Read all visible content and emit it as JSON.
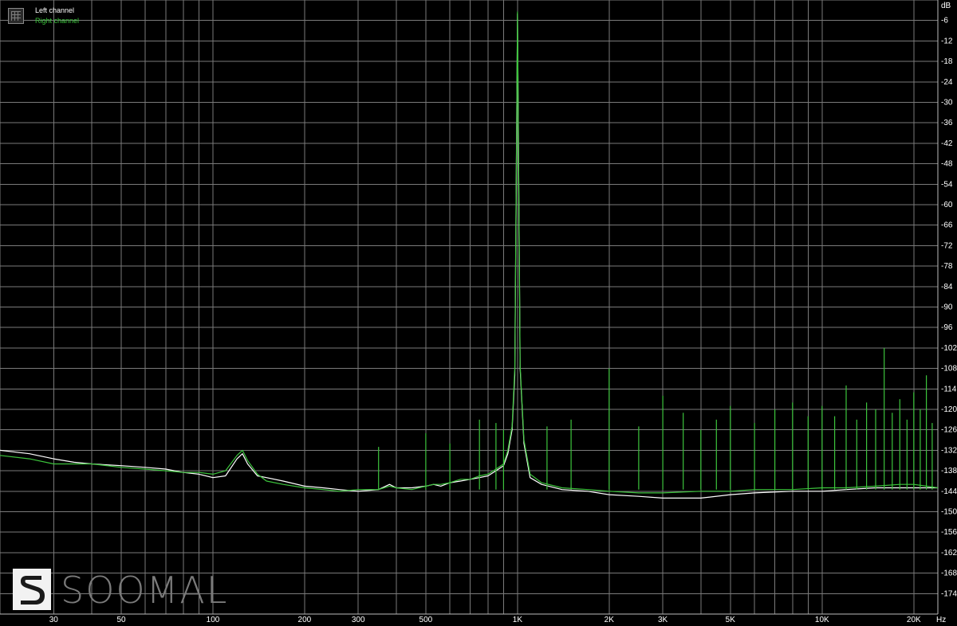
{
  "legend": {
    "left": "Left channel",
    "right": "Right channel"
  },
  "logo": {
    "text": "SOOMAL"
  },
  "colors": {
    "background": "#000000",
    "grid": "#7a7a7a",
    "left_channel": "#ffffff",
    "right_channel": "#3cc43c"
  },
  "chart_data": {
    "type": "line",
    "title": "",
    "xlabel": "Hz",
    "ylabel": "dB",
    "x_scale": "log",
    "xlim": [
      20,
      24000
    ],
    "ylim": [
      -180,
      0
    ],
    "grid": true,
    "legend_position": "top-left",
    "x_ticks": [
      {
        "value": 30,
        "label": "30"
      },
      {
        "value": 50,
        "label": "50"
      },
      {
        "value": 100,
        "label": "100"
      },
      {
        "value": 200,
        "label": "200"
      },
      {
        "value": 300,
        "label": "300"
      },
      {
        "value": 500,
        "label": "500"
      },
      {
        "value": 1000,
        "label": "1K"
      },
      {
        "value": 2000,
        "label": "2K"
      },
      {
        "value": 3000,
        "label": "3K"
      },
      {
        "value": 5000,
        "label": "5K"
      },
      {
        "value": 10000,
        "label": "10K"
      },
      {
        "value": 20000,
        "label": "20K"
      }
    ],
    "y_ticks": [
      -6,
      -12,
      -18,
      -24,
      -30,
      -36,
      -42,
      -48,
      -54,
      -60,
      -66,
      -72,
      -78,
      -84,
      -90,
      -96,
      -102,
      -108,
      -114,
      -120,
      -126,
      -132,
      -138,
      -144,
      -150,
      -156,
      -162,
      -168,
      -174
    ],
    "series": [
      {
        "name": "Left channel",
        "color": "#ffffff",
        "x": [
          20,
          25,
          30,
          35,
          40,
          50,
          60,
          70,
          80,
          90,
          100,
          110,
          120,
          125,
          130,
          140,
          150,
          170,
          200,
          230,
          260,
          300,
          350,
          380,
          400,
          450,
          500,
          530,
          560,
          600,
          650,
          700,
          750,
          800,
          850,
          900,
          930,
          960,
          980,
          1000,
          1020,
          1050,
          1100,
          1200,
          1400,
          1700,
          2000,
          2500,
          3000,
          4000,
          5000,
          6000,
          8000,
          10000,
          12000,
          15000,
          18000,
          20000,
          22000,
          24000
        ],
        "y": [
          -132,
          -133,
          -134.5,
          -135.5,
          -136,
          -136.5,
          -137,
          -137.5,
          -138.5,
          -139,
          -140,
          -139.5,
          -134.5,
          -133,
          -136,
          -139.5,
          -140,
          -141,
          -142.5,
          -143,
          -143.5,
          -144,
          -143.5,
          -142,
          -143,
          -143,
          -142.5,
          -142,
          -142.5,
          -141.5,
          -141,
          -140.5,
          -140,
          -139.5,
          -138,
          -136.5,
          -133,
          -126,
          -110,
          -4,
          -108,
          -130,
          -140,
          -142,
          -143.5,
          -144,
          -145,
          -145.5,
          -146,
          -146,
          -145,
          -144.5,
          -144,
          -144,
          -143.5,
          -143,
          -143,
          -143,
          -143,
          -143
        ]
      },
      {
        "name": "Right channel",
        "color": "#3cc43c",
        "x": [
          20,
          25,
          30,
          35,
          40,
          50,
          60,
          70,
          80,
          90,
          100,
          110,
          120,
          125,
          130,
          140,
          150,
          170,
          200,
          230,
          260,
          300,
          350,
          380,
          400,
          450,
          500,
          530,
          560,
          600,
          650,
          700,
          750,
          800,
          850,
          900,
          930,
          960,
          980,
          1000,
          1020,
          1050,
          1100,
          1200,
          1400,
          1700,
          2000,
          2500,
          3000,
          4000,
          5000,
          6000,
          8000,
          10000,
          12000,
          15000,
          18000,
          20000,
          22000,
          24000
        ],
        "y": [
          -133.5,
          -134.5,
          -136,
          -136,
          -136,
          -137,
          -137.5,
          -138,
          -138.5,
          -138.5,
          -139,
          -138,
          -133.5,
          -132,
          -135,
          -139,
          -141,
          -142,
          -143,
          -143.5,
          -144,
          -143.5,
          -143.5,
          -142.5,
          -143,
          -143.5,
          -142.5,
          -142,
          -142,
          -141.5,
          -140.5,
          -140.5,
          -139.5,
          -139,
          -137.5,
          -136,
          -132,
          -125,
          -108,
          -3.5,
          -107,
          -129,
          -139,
          -141.5,
          -143,
          -143.5,
          -144,
          -144.5,
          -144.5,
          -144,
          -144,
          -143.5,
          -143.5,
          -143,
          -143,
          -142.5,
          -142,
          -142,
          -142.5,
          -143
        ]
      }
    ],
    "spurs": [
      {
        "x": 350,
        "y": -131
      },
      {
        "x": 500,
        "y": -127
      },
      {
        "x": 600,
        "y": -130
      },
      {
        "x": 750,
        "y": -123
      },
      {
        "x": 850,
        "y": -124
      },
      {
        "x": 900,
        "y": -126
      },
      {
        "x": 1250,
        "y": -125
      },
      {
        "x": 1500,
        "y": -123
      },
      {
        "x": 2000,
        "y": -108
      },
      {
        "x": 2500,
        "y": -125
      },
      {
        "x": 3000,
        "y": -116
      },
      {
        "x": 3500,
        "y": -121
      },
      {
        "x": 4000,
        "y": -126
      },
      {
        "x": 4500,
        "y": -123
      },
      {
        "x": 5000,
        "y": -119
      },
      {
        "x": 6000,
        "y": -124
      },
      {
        "x": 7000,
        "y": -120
      },
      {
        "x": 8000,
        "y": -118
      },
      {
        "x": 9000,
        "y": -122
      },
      {
        "x": 10000,
        "y": -119
      },
      {
        "x": 11000,
        "y": -122
      },
      {
        "x": 12000,
        "y": -113
      },
      {
        "x": 13000,
        "y": -123
      },
      {
        "x": 14000,
        "y": -118
      },
      {
        "x": 15000,
        "y": -120
      },
      {
        "x": 16000,
        "y": -102
      },
      {
        "x": 17000,
        "y": -121
      },
      {
        "x": 18000,
        "y": -117
      },
      {
        "x": 19000,
        "y": -123
      },
      {
        "x": 20000,
        "y": -115
      },
      {
        "x": 21000,
        "y": -120
      },
      {
        "x": 22000,
        "y": -110
      },
      {
        "x": 23000,
        "y": -124
      }
    ]
  }
}
